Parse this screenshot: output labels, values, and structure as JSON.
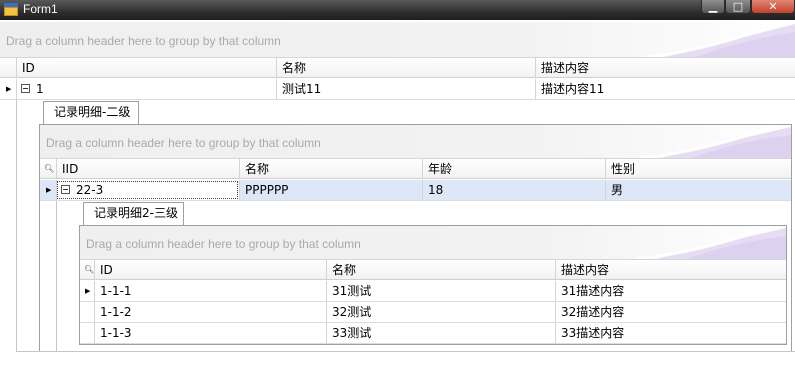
{
  "window": {
    "title": "Form1",
    "min": "▁",
    "max": "□",
    "close": "✕"
  },
  "group_hint": "Drag a column header here to group by that column",
  "level1": {
    "columns": [
      "ID",
      "名称",
      "描述内容"
    ],
    "rows": [
      {
        "id": "1",
        "name": "测试11",
        "desc": "描述内容11"
      }
    ]
  },
  "level2": {
    "tab": "记录明细-二级",
    "columns": [
      "IID",
      "名称",
      "年龄",
      "性别"
    ],
    "rows": [
      {
        "iid": "22-3",
        "name": "PPPPPP",
        "age": "18",
        "gender": "男"
      }
    ]
  },
  "level3": {
    "tab": "记录明细2-三级",
    "columns": [
      "ID",
      "名称",
      "描述内容"
    ],
    "rows": [
      {
        "id": "1-1-1",
        "name": "31测试",
        "desc": "31描述内容"
      },
      {
        "id": "1-1-2",
        "name": "32测试",
        "desc": "32描述内容"
      },
      {
        "id": "1-1-3",
        "name": "33测试",
        "desc": "33描述内容"
      }
    ]
  }
}
